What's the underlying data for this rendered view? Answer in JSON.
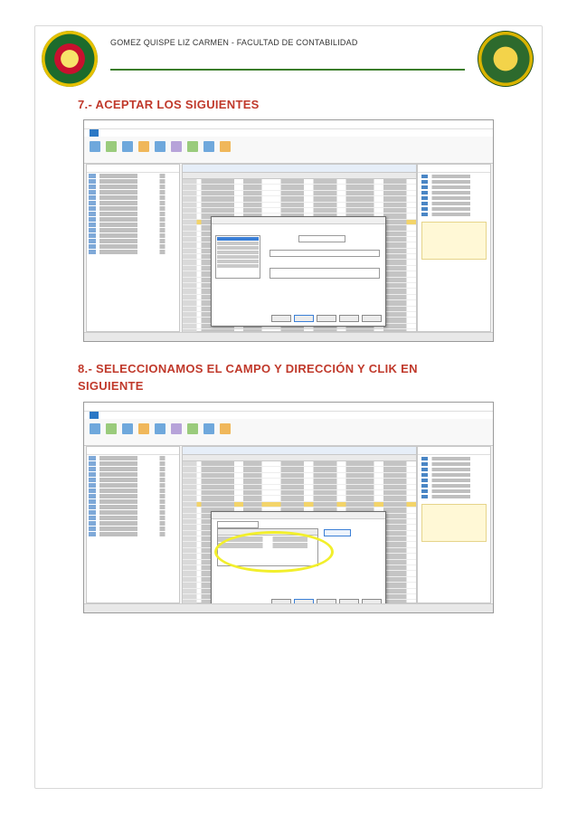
{
  "header": {
    "title": "GOMEZ QUISPE LIZ CARMEN - FACULTAD DE CONTABILIDAD"
  },
  "sections": [
    {
      "heading": "7.- ACEPTAR LOS SIGUIENTES"
    },
    {
      "heading": "8.- SELECCIONAMOS EL CAMPO Y DIRECCIÓN Y CLIK EN SIGUIENTE"
    }
  ],
  "colors": {
    "heading": "#c0392b",
    "header_rule": "#3a7d2a",
    "highlight": "#f2ef2c",
    "ribbon_active": "#2b78c5"
  }
}
